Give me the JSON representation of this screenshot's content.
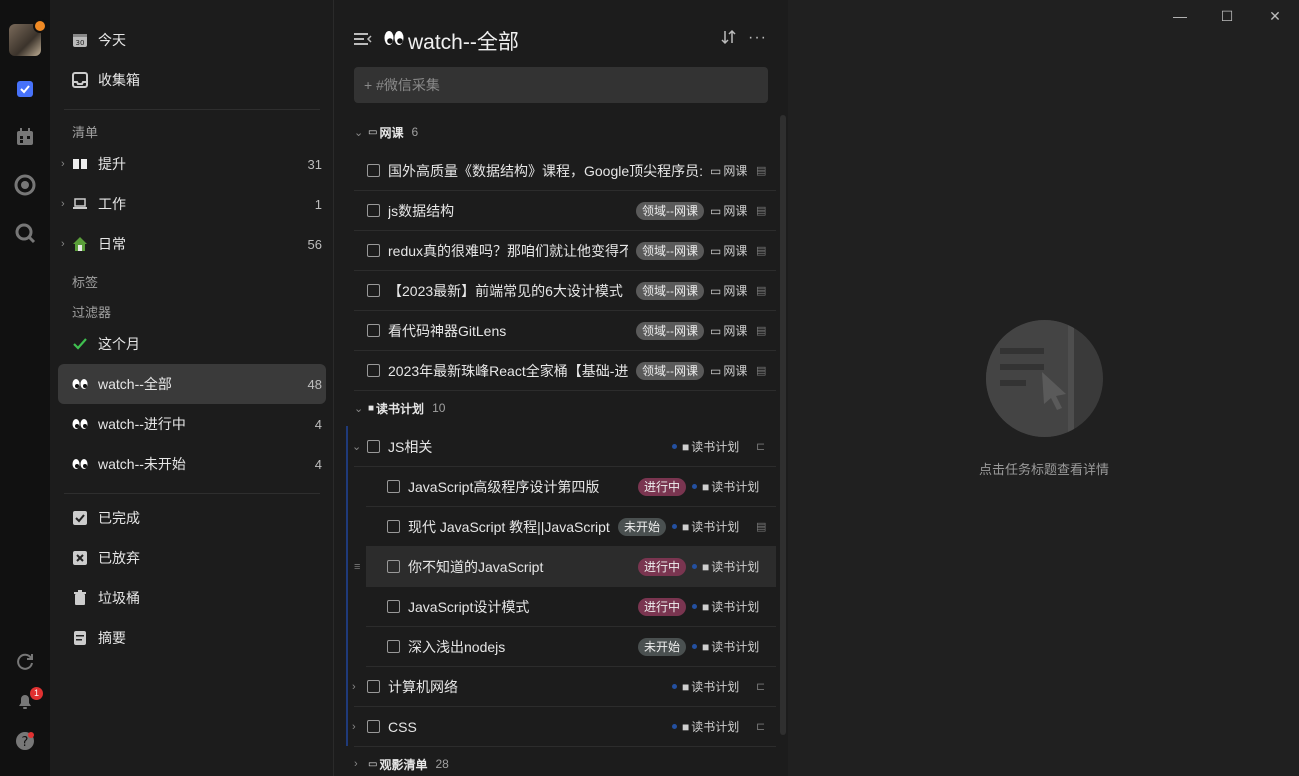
{
  "rail": {
    "notification_count": "1",
    "icons": [
      "avatar",
      "task-check-icon",
      "calendar-icon",
      "focus-icon",
      "search-icon",
      "sync-icon",
      "bell-icon",
      "help-icon"
    ]
  },
  "sidebar": {
    "smart": [
      {
        "label": "今天",
        "icon": "calendar-30-icon",
        "date": "30"
      },
      {
        "label": "收集箱",
        "icon": "inbox-icon"
      }
    ],
    "lists_header": "清单",
    "lists": [
      {
        "label": "提升",
        "count": "31",
        "icon": "book-icon"
      },
      {
        "label": "工作",
        "count": "1",
        "icon": "laptop-icon"
      },
      {
        "label": "日常",
        "count": "56",
        "icon": "house-icon"
      }
    ],
    "tags_header": "标签",
    "filters_header": "过滤器",
    "filters": [
      {
        "label": "这个月",
        "count": "",
        "icon": "check-icon"
      },
      {
        "label": "watch--全部",
        "count": "48",
        "icon": "eyes-icon",
        "active": true
      },
      {
        "label": "watch--进行中",
        "count": "4",
        "icon": "eyes-icon"
      },
      {
        "label": "watch--未开始",
        "count": "4",
        "icon": "eyes-icon"
      }
    ],
    "bottom": [
      {
        "label": "已完成",
        "icon": "checked-box-icon"
      },
      {
        "label": "已放弃",
        "icon": "x-box-icon"
      },
      {
        "label": "垃圾桶",
        "icon": "trash-icon"
      },
      {
        "label": "摘要",
        "icon": "summary-icon"
      }
    ]
  },
  "main": {
    "title": "watch--全部",
    "add_placeholder": "+ #微信采集",
    "groups": [
      {
        "name": "网课",
        "count": "6",
        "tasks": [
          {
            "title": "国外高质量《数据结构》课程，Google顶尖程序员:",
            "tag": "",
            "list": "网课"
          },
          {
            "title": "js数据结构",
            "tag": "领域--网课",
            "list": "网课"
          },
          {
            "title": "redux真的很难吗？那咱们就让他变得不",
            "tag": "领域--网课",
            "list": "网课"
          },
          {
            "title": "【2023最新】前端常见的6大设计模式",
            "tag": "领域--网课",
            "list": "网课"
          },
          {
            "title": "看代码神器GitLens",
            "tag": "领域--网课",
            "list": "网课"
          },
          {
            "title": "2023年最新珠峰React全家桶【基础-进",
            "tag": "领域--网课",
            "list": "网课"
          }
        ]
      },
      {
        "name": "读书计划",
        "count": "10",
        "parent": {
          "title": "JS相关",
          "list": "读书计划"
        },
        "subtasks": [
          {
            "title": "JavaScript高级程序设计第四版",
            "tag": "进行中",
            "list": "读书计划"
          },
          {
            "title": "现代 JavaScript 教程||JavaScript",
            "tag": "未开始",
            "list": "读书计划"
          },
          {
            "title": "你不知道的JavaScript",
            "tag": "进行中",
            "list": "读书计划"
          },
          {
            "title": "JavaScript设计模式",
            "tag": "进行中",
            "list": "读书计划"
          },
          {
            "title": "深入浅出nodejs",
            "tag": "未开始",
            "list": "读书计划"
          }
        ],
        "siblings": [
          {
            "title": "计算机网络",
            "list": "读书计划"
          },
          {
            "title": "CSS",
            "list": "读书计划"
          }
        ]
      },
      {
        "name": "观影清单",
        "count": "28"
      }
    ]
  },
  "detail": {
    "empty_text": "点击任务标题查看详情"
  },
  "colors": {
    "accent": "#4772fa",
    "tag_domain": "#5a5a5a",
    "tag_in_progress": "#7a3550",
    "tag_not_started": "#4a5050"
  }
}
